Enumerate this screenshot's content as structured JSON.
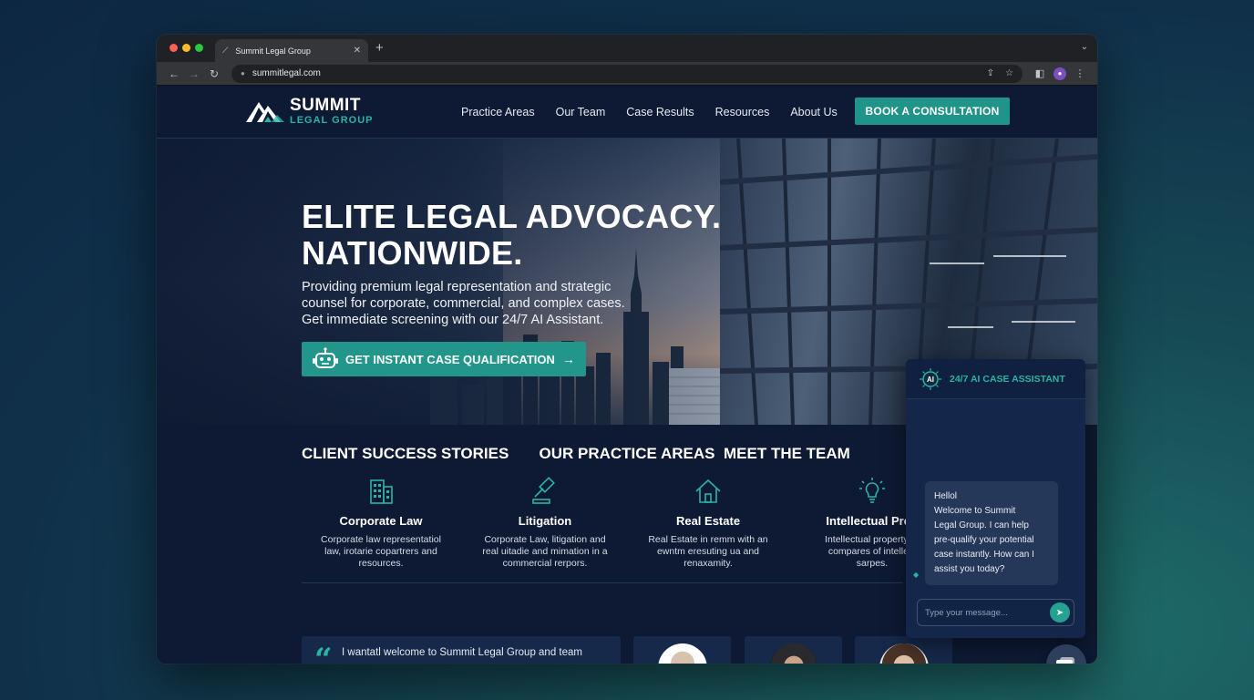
{
  "browser": {
    "tab_title": "Summit Legal Group",
    "url": "summitlegal.com",
    "new_tab_label": "+"
  },
  "header": {
    "logo_line1": "SUMMIT",
    "logo_line2": "LEGAL GROUP",
    "nav": [
      "Practice Areas",
      "Our Team",
      "Case Results",
      "Resources",
      "About Us"
    ],
    "cta_label": "BOOK A CONSULTATION"
  },
  "hero": {
    "title_line1": "ELITE LEGAL ADVOCACY.",
    "title_line2": "NATIONWIDE.",
    "subtitle_line1": "Providing premium legal representation and strategic",
    "subtitle_line2": "counsel for corporate, commercial, and complex cases.",
    "subtitle_line3": "Get immediate screening with our 24/7 AI Assistant.",
    "cta_label": "GET INSTANT CASE QUALIFICATION",
    "cta_arrow": "→"
  },
  "practice": {
    "heading": "OUR PRACTICE AREAS",
    "cards": [
      {
        "title": "Corporate Law",
        "l1": "Corporate law representatiol",
        "l2": "law, irotarie copartrers and",
        "l3": "resources."
      },
      {
        "title": "Litigation",
        "l1": "Corporate Law, litigation and",
        "l2": "real uitadie and mimation in a",
        "l3": "commercial rerpors."
      },
      {
        "title": "Real Estate",
        "l1": "Real Estate in remm with an",
        "l2": "ewntm eresuting ua and",
        "l3": "renaxamity."
      },
      {
        "title": "Intellectual Prop",
        "l1": "Intellectual property ar",
        "l2": "compares of intellect",
        "l3": "sarpes."
      }
    ]
  },
  "stories": {
    "heading": "CLIENT SUCCESS STORIES",
    "quote_mark": "“",
    "quote_text": "I wantatl welcome to Summit Legal Group and team"
  },
  "team": {
    "heading": "MEET THE TEAM"
  },
  "chat": {
    "badge": "AI",
    "title": "24/7 AI CASE ASSISTANT",
    "message_lines": [
      "Hellol",
      "Welcome to Summit",
      "Legal Group. I can help",
      "pre-qualify your potential",
      "case instantly. How can I",
      "assist you today?"
    ],
    "input_placeholder": "Type your message..."
  },
  "colors": {
    "accent": "#21948a",
    "navy": "#0e1a33",
    "teal_text": "#2bb3a3"
  }
}
